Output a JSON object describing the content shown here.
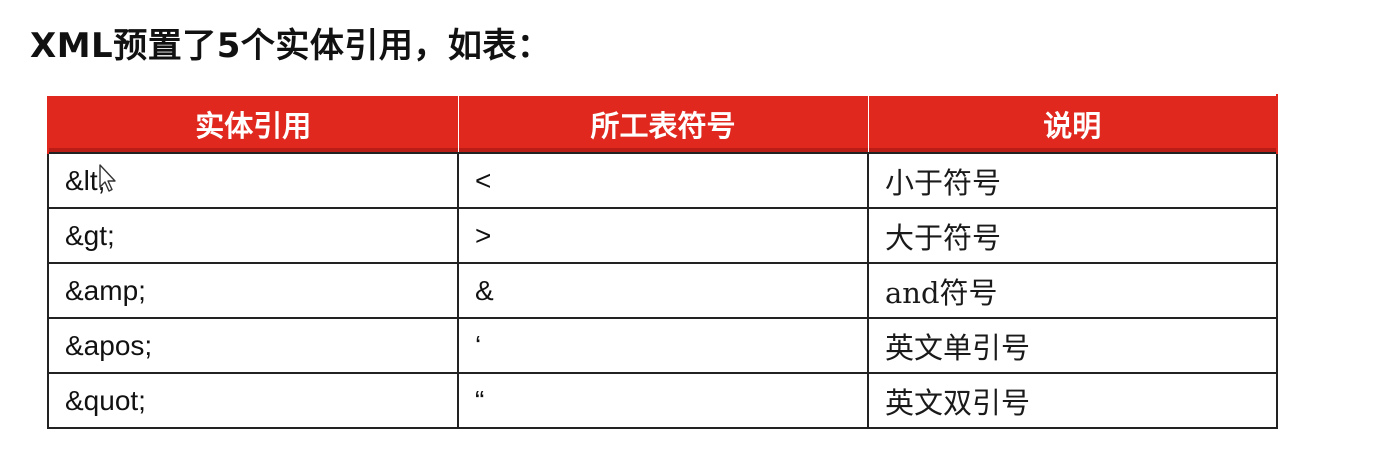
{
  "heading": "XML预置了5个实体引用，如表：",
  "table": {
    "headers": [
      "实体引用",
      "所工表符号",
      "说明"
    ],
    "rows": [
      {
        "entity": "&lt;",
        "symbol": "<",
        "description": "小于符号"
      },
      {
        "entity": "&gt;",
        "symbol": ">",
        "description": "大于符号"
      },
      {
        "entity": "&amp;",
        "symbol": "&",
        "description": "and符号"
      },
      {
        "entity": "&apos;",
        "symbol": "‘",
        "description": "英文单引号"
      },
      {
        "entity": "&quot;",
        "symbol": "“",
        "description": "英文双引号"
      }
    ]
  },
  "colors": {
    "header_bg": "#e0281f",
    "header_text": "#ffffff",
    "border": "#222222"
  },
  "icons": {
    "cursor": "mouse-pointer-icon"
  }
}
